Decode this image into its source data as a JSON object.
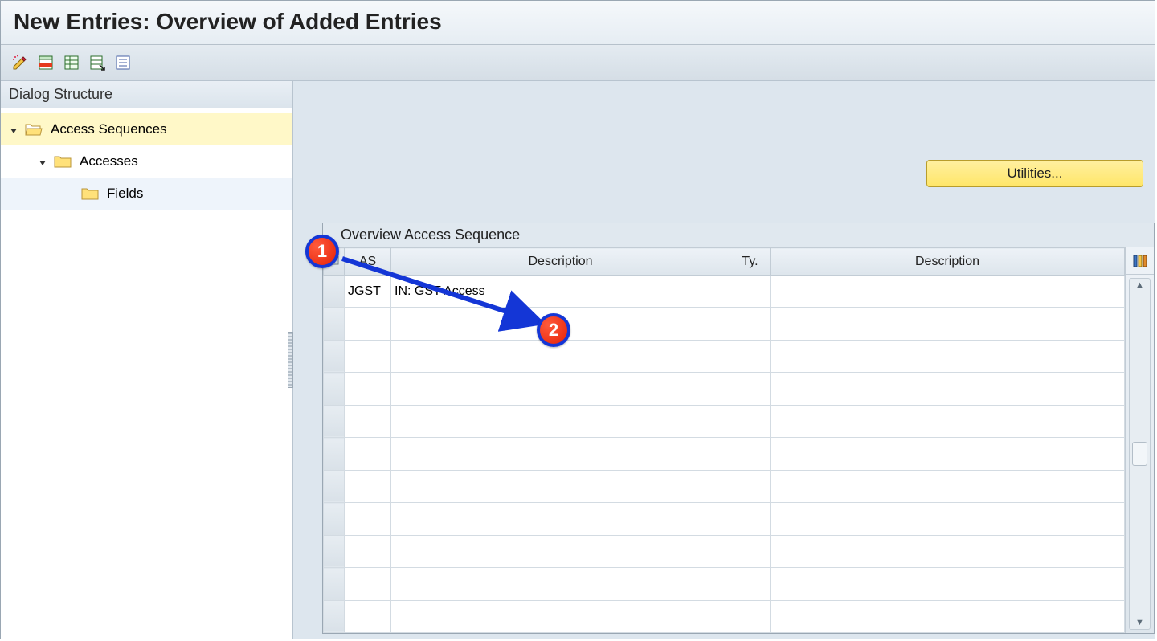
{
  "title": "New Entries: Overview of Added Entries",
  "toolbar": {
    "icons": [
      "edit",
      "display-change",
      "table-settings",
      "table-export",
      "list"
    ]
  },
  "sidebar": {
    "header": "Dialog Structure",
    "nodes": {
      "root": "Access Sequences",
      "child1": "Accesses",
      "child2": "Fields"
    }
  },
  "utilities_label": "Utilities...",
  "table": {
    "title": "Overview Access Sequence",
    "columns": {
      "as": "AS",
      "desc1": "Description",
      "ty": "Ty.",
      "desc2": "Description"
    },
    "rows": [
      {
        "as": "JGST",
        "desc1": "IN: GST Access",
        "ty": "",
        "desc2": ""
      }
    ],
    "blank_rows": 10
  },
  "annotations": {
    "b1": "1",
    "b2": "2"
  }
}
